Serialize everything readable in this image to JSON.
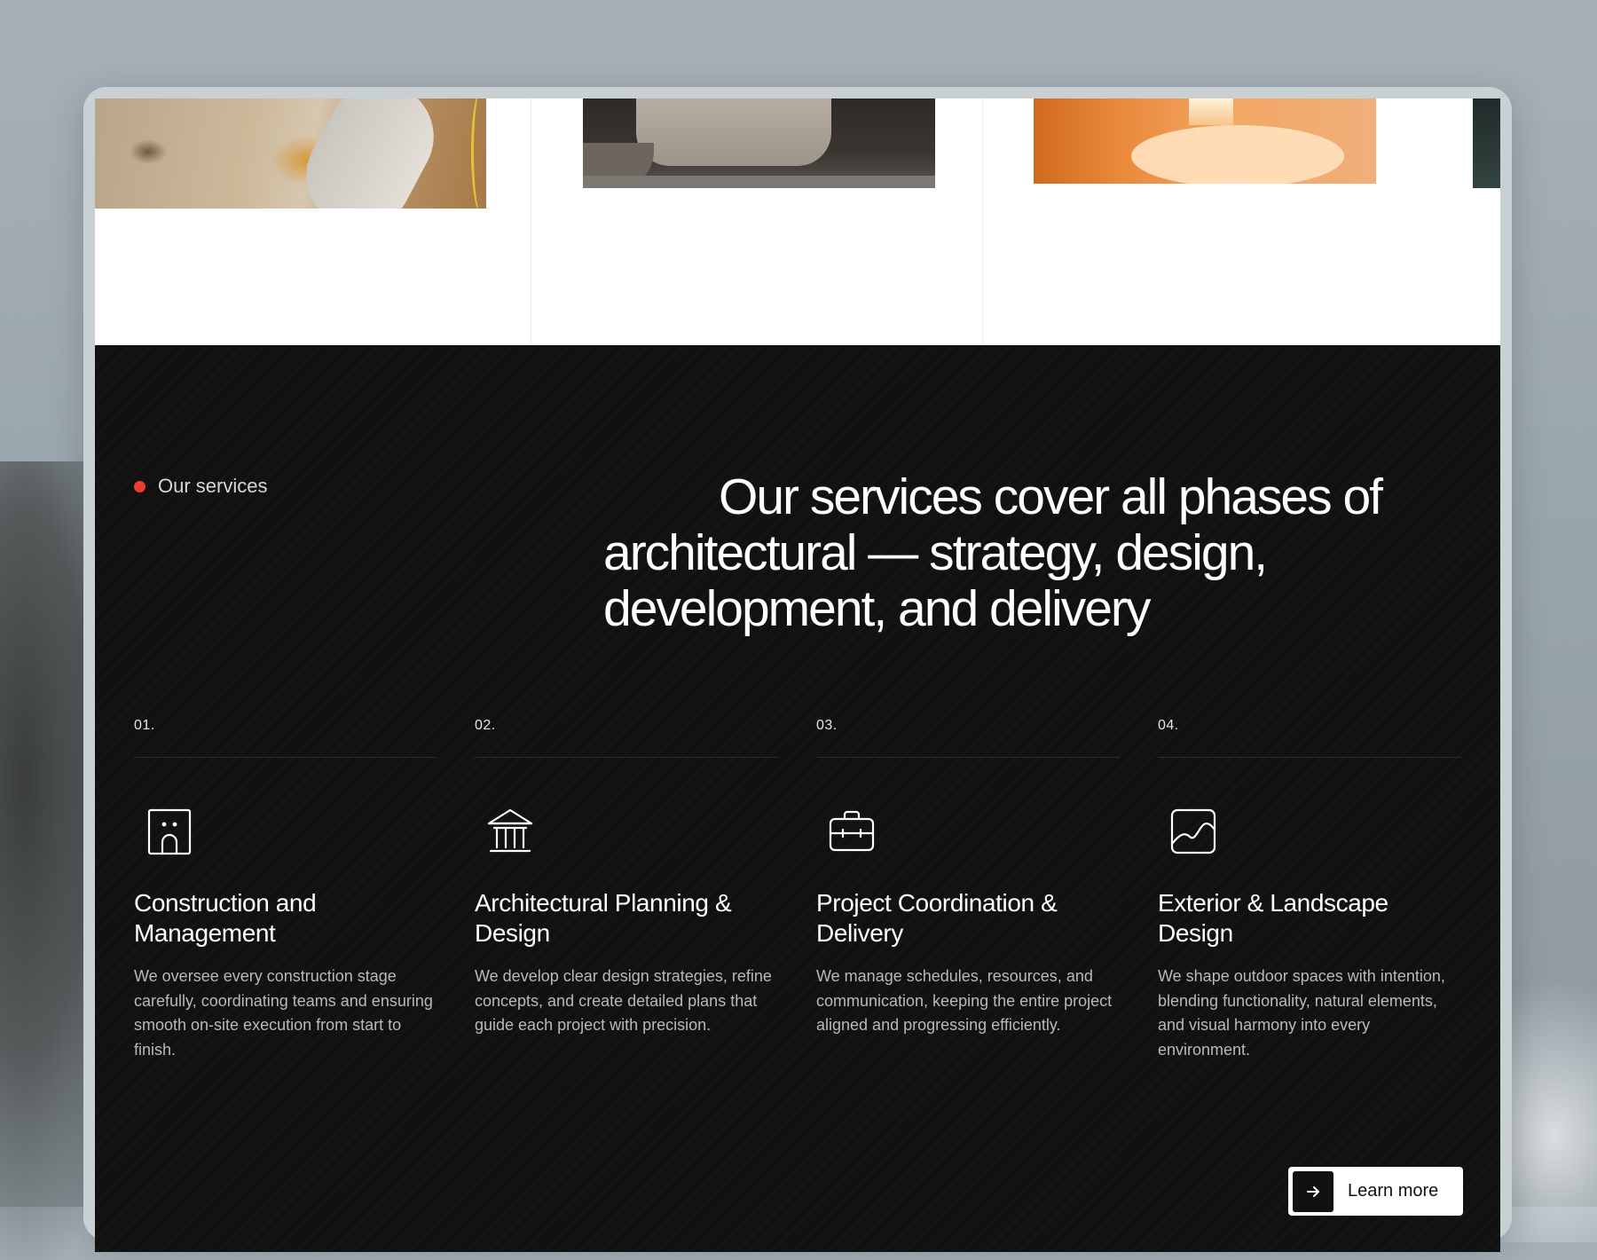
{
  "services": {
    "eyebrow": "Our services",
    "headline": "Our services cover all phases of architectural — strategy, design, development, and delivery",
    "items": [
      {
        "number": "01.",
        "icon": "building-icon",
        "title": "Construction and Management",
        "description": "We oversee every construction stage carefully, coordinating teams and ensuring smooth on-site execution from start to finish."
      },
      {
        "number": "02.",
        "icon": "institution-icon",
        "title": "Architectural Planning & Design",
        "description": "We develop clear design strategies, refine concepts, and create detailed plans that guide each project with precision."
      },
      {
        "number": "03.",
        "icon": "briefcase-icon",
        "title": "Project Coordination & Delivery",
        "description": "We manage schedules, resources, and communication, keeping the entire project aligned and progressing efficiently."
      },
      {
        "number": "04.",
        "icon": "landscape-icon",
        "title": "Exterior & Landscape Design",
        "description": "We shape outdoor spaces with intention, blending functionality, natural elements, and visual harmony into every environment."
      }
    ],
    "cta": {
      "label": "Learn more",
      "icon": "arrow-right-icon"
    }
  },
  "colors": {
    "accent_dot": "#ef3b2c",
    "section_bg": "#111112",
    "text_primary": "#ffffff",
    "text_secondary": "#b9b9b9"
  }
}
